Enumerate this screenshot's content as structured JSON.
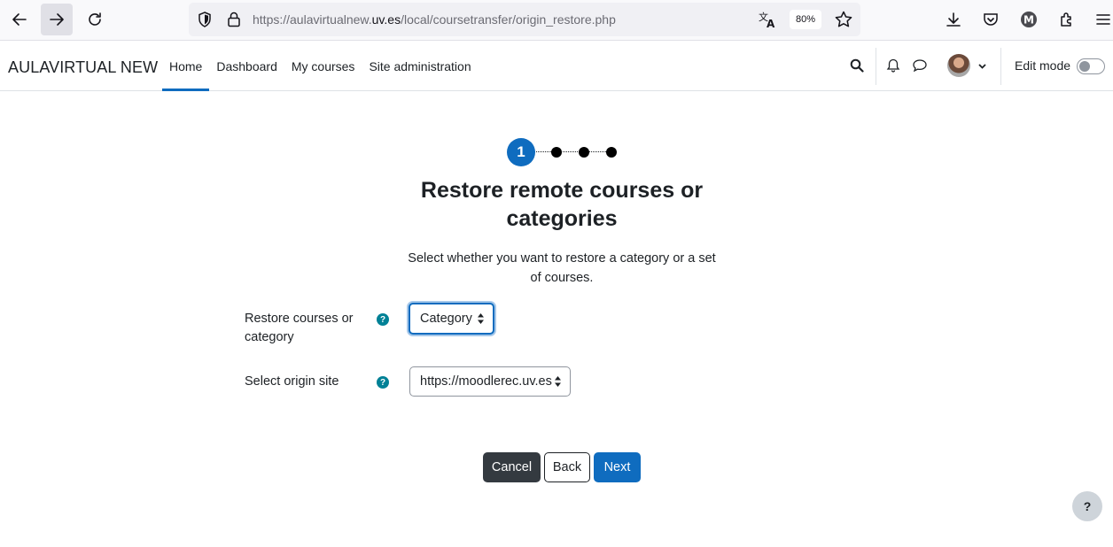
{
  "browser": {
    "url_prefix": "https://aulavirtualnew.",
    "url_host": "uv.es",
    "url_path": "/local/coursetransfer/origin_restore.php",
    "zoom": "80%"
  },
  "navbar": {
    "brand": "AULAVIRTUAL NEW",
    "items": [
      {
        "label": "Home",
        "active": true
      },
      {
        "label": "Dashboard",
        "active": false
      },
      {
        "label": "My courses",
        "active": false
      },
      {
        "label": "Site administration",
        "active": false
      }
    ],
    "edit_mode_label": "Edit mode",
    "edit_mode_on": false
  },
  "stepper": {
    "current_step": "1",
    "total_steps": 4
  },
  "page": {
    "title": "Restore remote courses or categories",
    "intro": "Select whether you want to restore a category or a set of courses."
  },
  "form": {
    "restore_type": {
      "label": "Restore courses or category",
      "value": "Category"
    },
    "origin_site": {
      "label": "Select origin site",
      "value": "https://moodlerec.uv.es"
    }
  },
  "buttons": {
    "cancel": "Cancel",
    "back": "Back",
    "next": "Next"
  },
  "footer": {
    "help_label": "?"
  },
  "colors": {
    "primary": "#0f6cbf",
    "dark": "#343a40",
    "help": "#008196"
  }
}
